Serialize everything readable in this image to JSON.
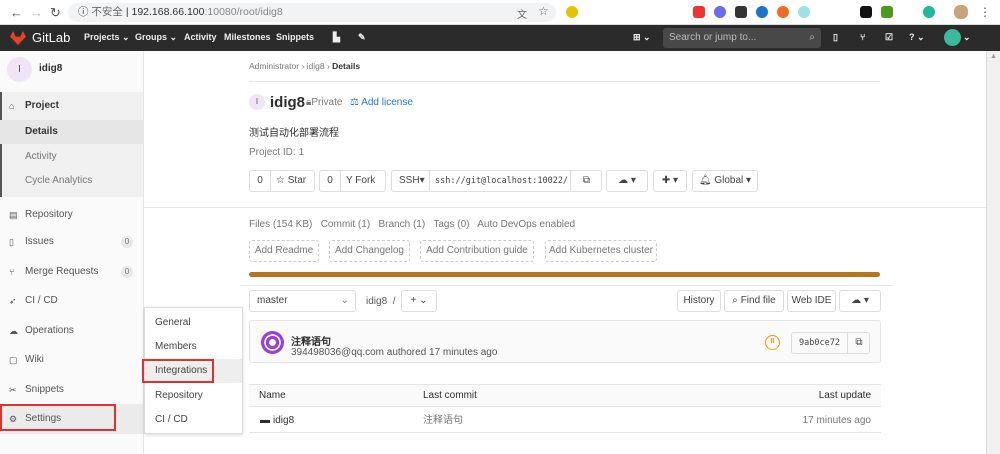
{
  "browser": {
    "security": "不安全",
    "url_host": "192.168.66.100",
    "url_rest": ":10080/root/idig8"
  },
  "header": {
    "brand": "GitLab",
    "nav": [
      "Projects",
      "Groups",
      "Activity",
      "Milestones",
      "Snippets"
    ],
    "search_placeholder": "Search or jump to..."
  },
  "sidebar": {
    "project_initial": "I",
    "project_name": "idig8",
    "items": [
      {
        "label": "Project",
        "icon": "home-icon"
      },
      {
        "label": "Details"
      },
      {
        "label": "Activity"
      },
      {
        "label": "Cycle Analytics"
      },
      {
        "label": "Repository",
        "icon": "doc-icon"
      },
      {
        "label": "Issues",
        "icon": "issues-icon",
        "count": "0"
      },
      {
        "label": "Merge Requests",
        "icon": "merge-icon",
        "count": "0"
      },
      {
        "label": "CI / CD",
        "icon": "rocket-icon"
      },
      {
        "label": "Operations",
        "icon": "cloud-gear-icon"
      },
      {
        "label": "Wiki",
        "icon": "book-icon"
      },
      {
        "label": "Snippets",
        "icon": "scissors-icon"
      },
      {
        "label": "Settings",
        "icon": "gear-icon"
      }
    ]
  },
  "settings_flyout": [
    "General",
    "Members",
    "Integrations",
    "Repository",
    "CI / CD"
  ],
  "breadcrumb": [
    "Administrator",
    "idig8",
    "Details"
  ],
  "project": {
    "initial": "I",
    "name": "idig8",
    "visibility": "Private",
    "add_license": "Add license",
    "description": "测试自动化部署流程",
    "project_id": "Project ID: 1"
  },
  "actions": {
    "star_count": "0",
    "star": "Star",
    "fork_count": "0",
    "fork": "Fork",
    "protocol": "SSH",
    "clone_url": "ssh://git@localhost:10022/",
    "notification": "Global"
  },
  "stats": [
    "Files (154 KB)",
    "Commit (1)",
    "Branch (1)",
    "Tags (0)",
    "Auto DevOps enabled"
  ],
  "add_buttons": [
    "Add Readme",
    "Add Changelog",
    "Add Contribution guide",
    "Add Kubernetes cluster"
  ],
  "language_bar": {
    "color": "#b5761f",
    "percent": 100
  },
  "tree": {
    "branch": "master",
    "path": "idig8",
    "history": "History",
    "find_file": "Find file",
    "web_ide": "Web IDE"
  },
  "commit": {
    "title": "注释语句",
    "meta": "394498036@qq.com authored 17 minutes ago",
    "sha": "9ab0ce72",
    "status": "pending"
  },
  "table": {
    "headers": [
      "Name",
      "Last commit",
      "Last update"
    ],
    "rows": [
      {
        "name": "idig8",
        "commit": "注释语句",
        "updated": "17 minutes ago"
      }
    ]
  }
}
